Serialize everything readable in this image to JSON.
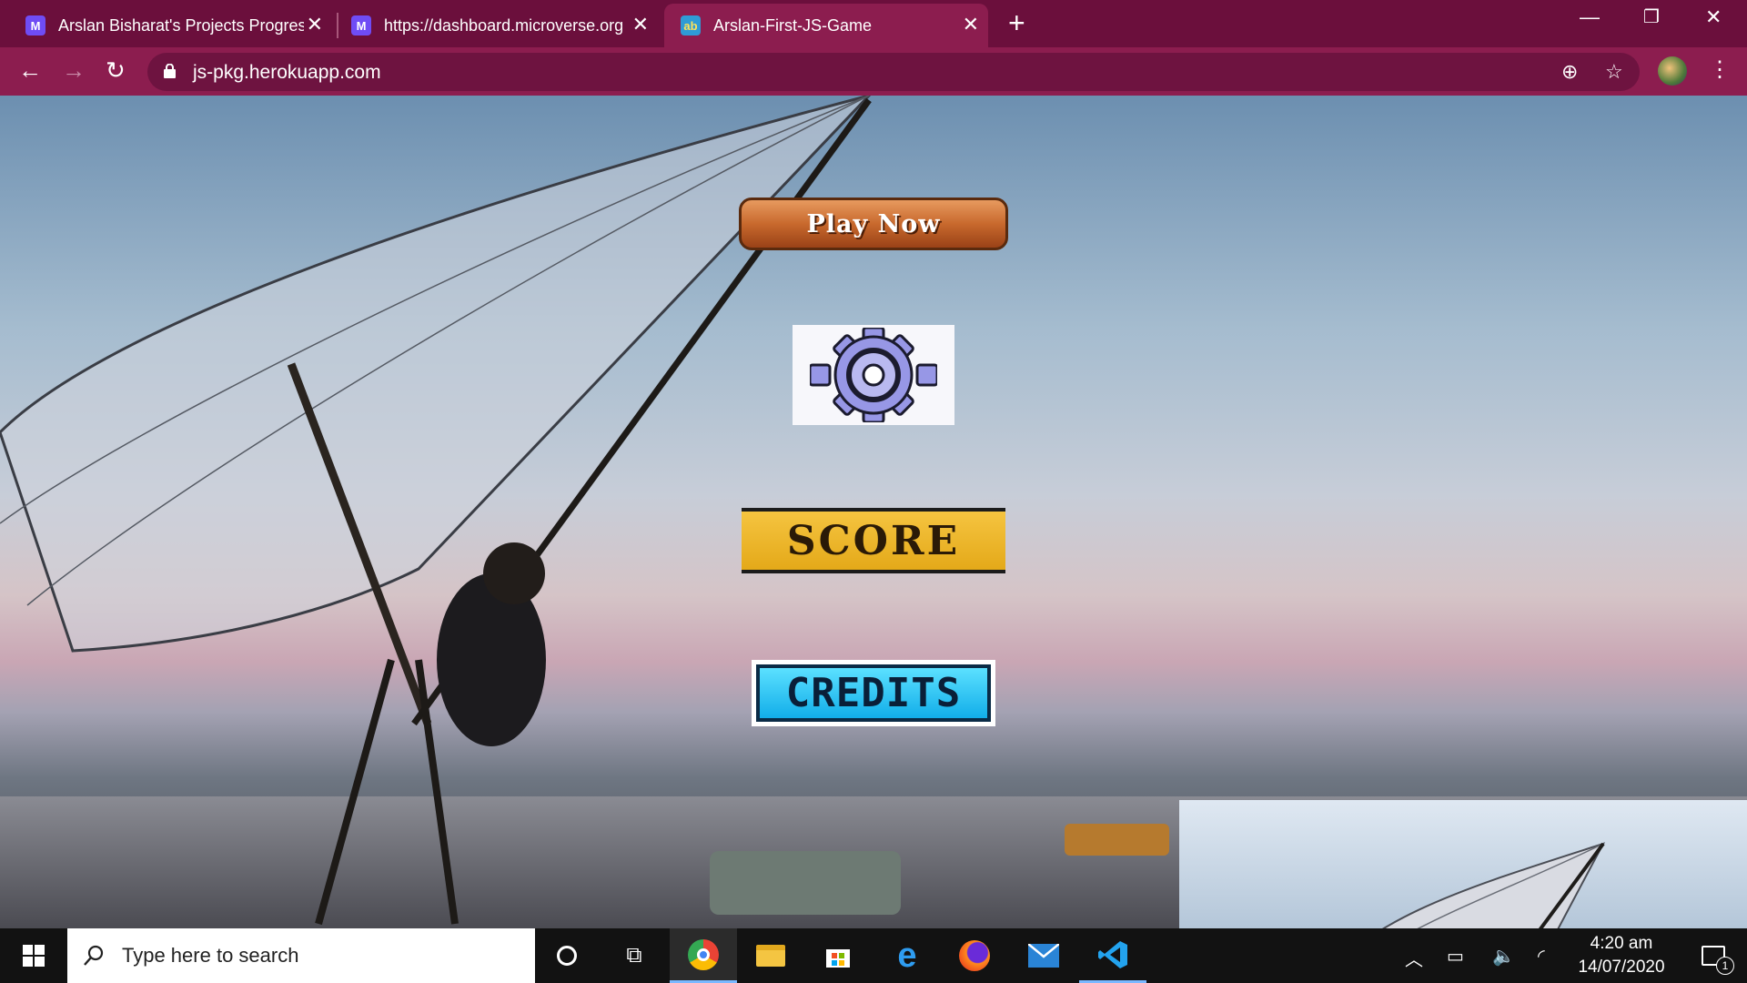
{
  "browser": {
    "tabs": [
      {
        "title": "Arslan Bisharat's Projects Progress",
        "icon": "microverse-icon"
      },
      {
        "title": "https://dashboard.microverse.org",
        "icon": "microverse-icon"
      },
      {
        "title": "Arslan-First-JS-Game",
        "icon": "game-icon",
        "favicon_text": "ab"
      }
    ],
    "active_tab": 2,
    "url": "js-pkg.herokuapp.com"
  },
  "game_menu": {
    "play_label": "Play Now",
    "score_label": "SCORE",
    "credits_label": "CREDITS"
  },
  "taskbar": {
    "search_placeholder": "Type here to search",
    "time": "4:20 am",
    "date": "14/07/2020",
    "notification_count": "1"
  },
  "colors": {
    "tabbar": "#6b0f3c",
    "toolbar": "#8c1d4f",
    "taskbar": "#121212"
  }
}
